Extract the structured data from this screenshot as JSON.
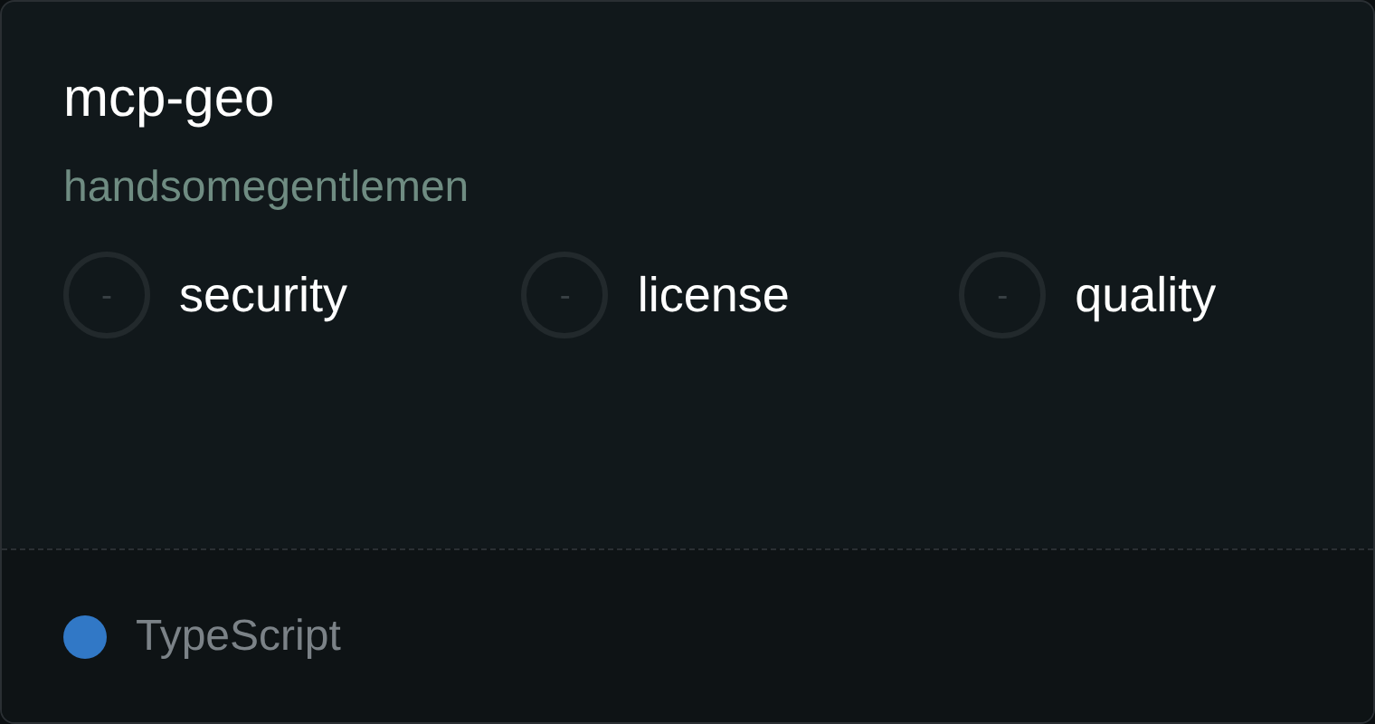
{
  "card": {
    "title": "mcp-geo",
    "author": "handsomegentlemen",
    "scores": [
      {
        "value": "-",
        "label": "security"
      },
      {
        "value": "-",
        "label": "license"
      },
      {
        "value": "-",
        "label": "quality"
      }
    ],
    "language": {
      "name": "TypeScript",
      "color": "#3178c6"
    }
  }
}
